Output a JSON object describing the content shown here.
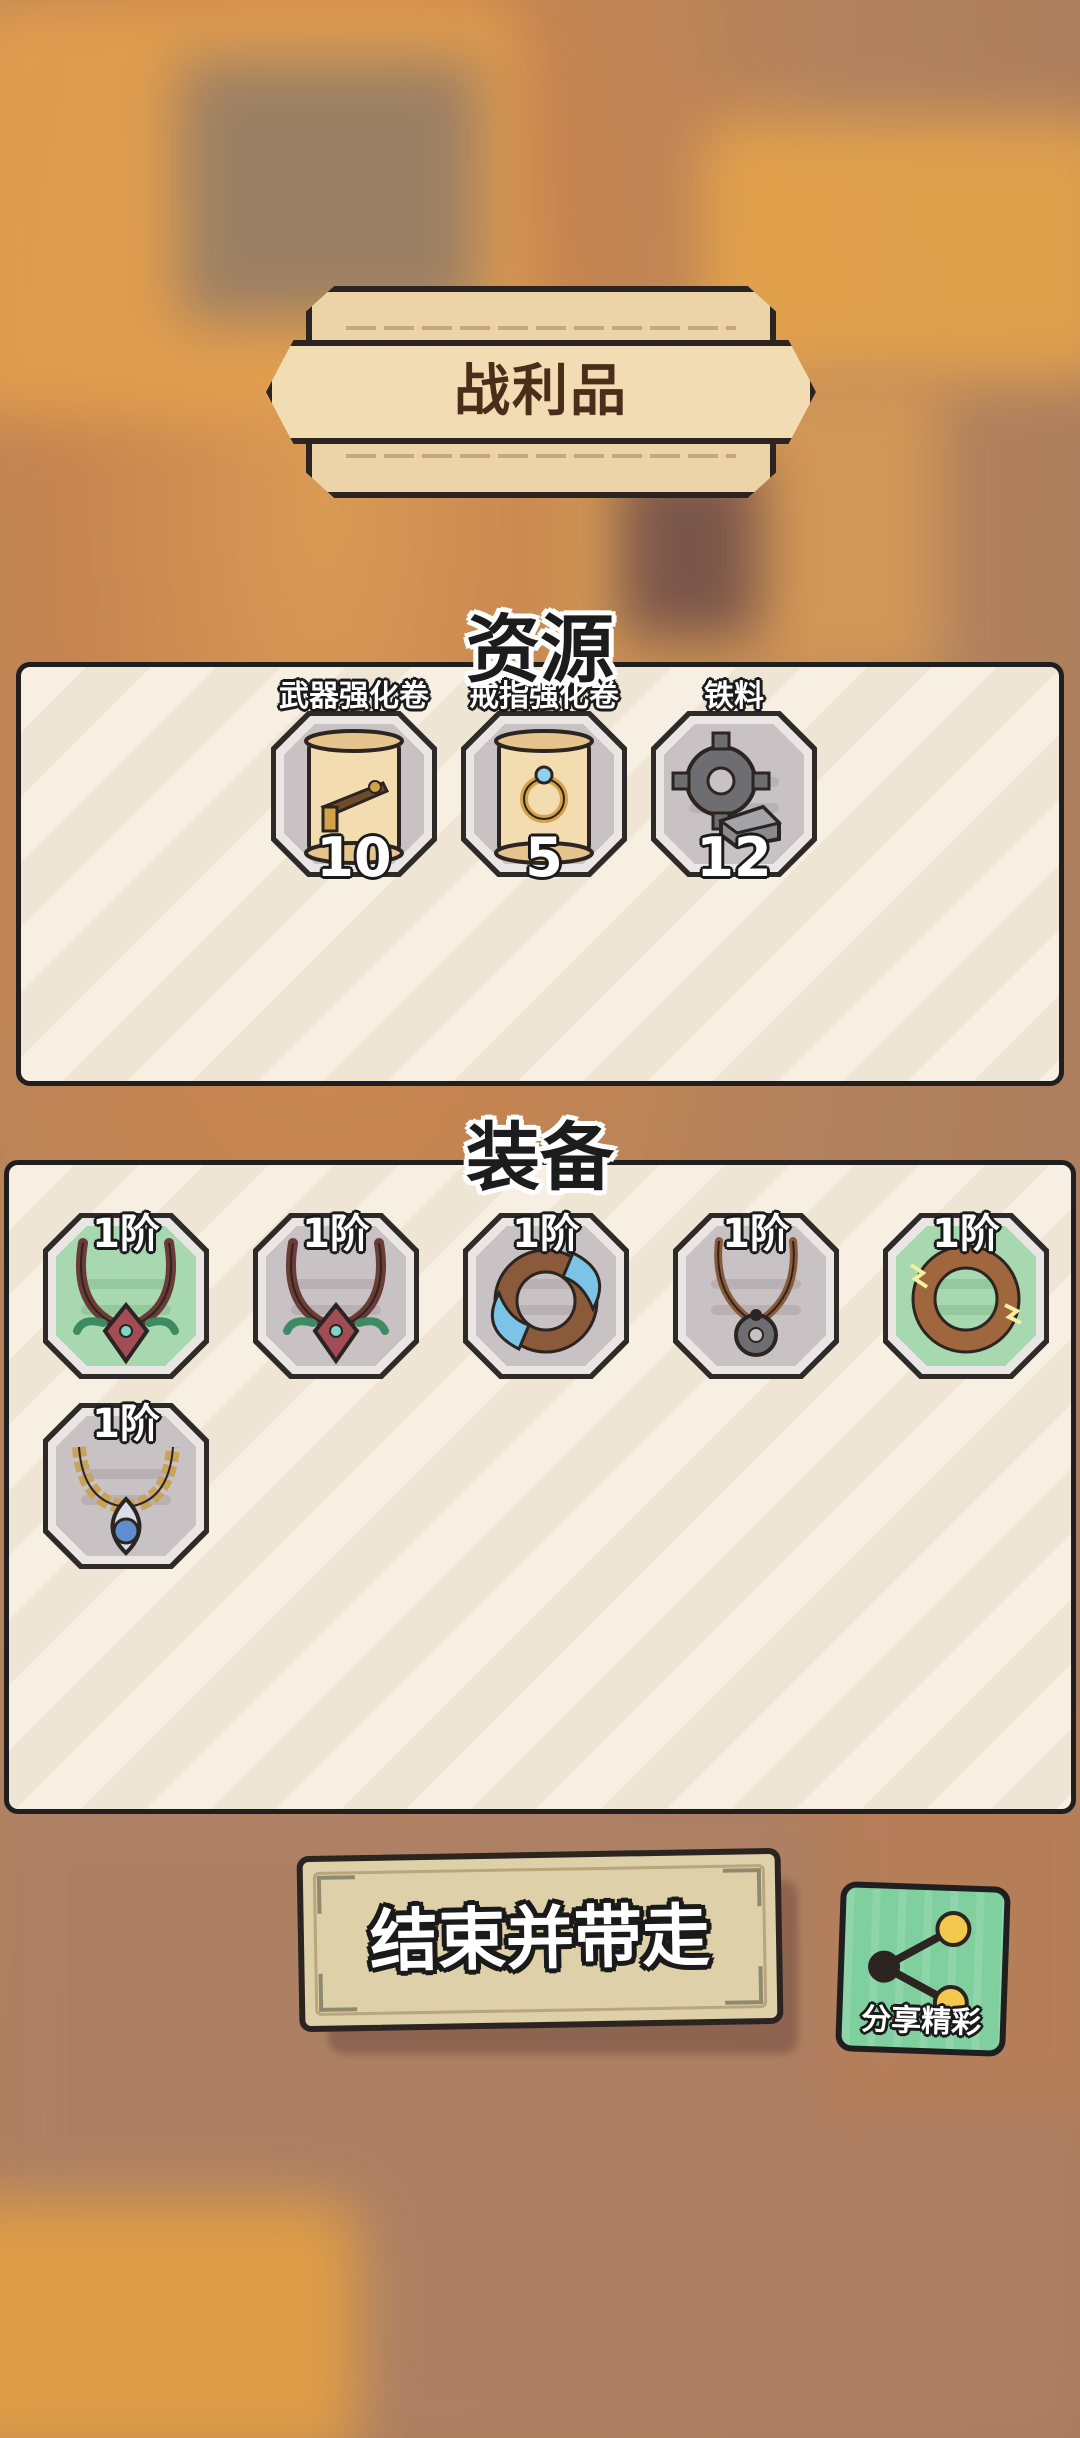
{
  "title": "战利品",
  "resources": {
    "heading": "资源",
    "items": [
      {
        "name": "武器强化卷",
        "count": "10",
        "icon": "weapon-scroll-icon"
      },
      {
        "name": "戒指强化卷",
        "count": "5",
        "icon": "ring-scroll-icon"
      },
      {
        "name": "铁料",
        "count": "12",
        "icon": "iron-gear-icon"
      }
    ]
  },
  "equipment": {
    "heading": "装备",
    "items": [
      {
        "tier": "1阶",
        "icon": "tribal-necklace-icon",
        "rarity": "green"
      },
      {
        "tier": "1阶",
        "icon": "tribal-necklace-icon",
        "rarity": "gray"
      },
      {
        "tier": "1阶",
        "icon": "water-ring-icon",
        "rarity": "gray"
      },
      {
        "tier": "1阶",
        "icon": "saw-pendant-icon",
        "rarity": "gray"
      },
      {
        "tier": "1阶",
        "icon": "lightning-ring-icon",
        "rarity": "green"
      },
      {
        "tier": "1阶",
        "icon": "blue-gem-necklace-icon",
        "rarity": "gray"
      }
    ]
  },
  "buttons": {
    "end": "结束并带走",
    "share": "分享精彩"
  },
  "colors": {
    "panel": "#f7efe2",
    "green_rarity": "#a8d8b0",
    "gray_rarity": "#c9c2c4",
    "share_button": "#7fcf9f",
    "end_button": "#ded0a8"
  }
}
